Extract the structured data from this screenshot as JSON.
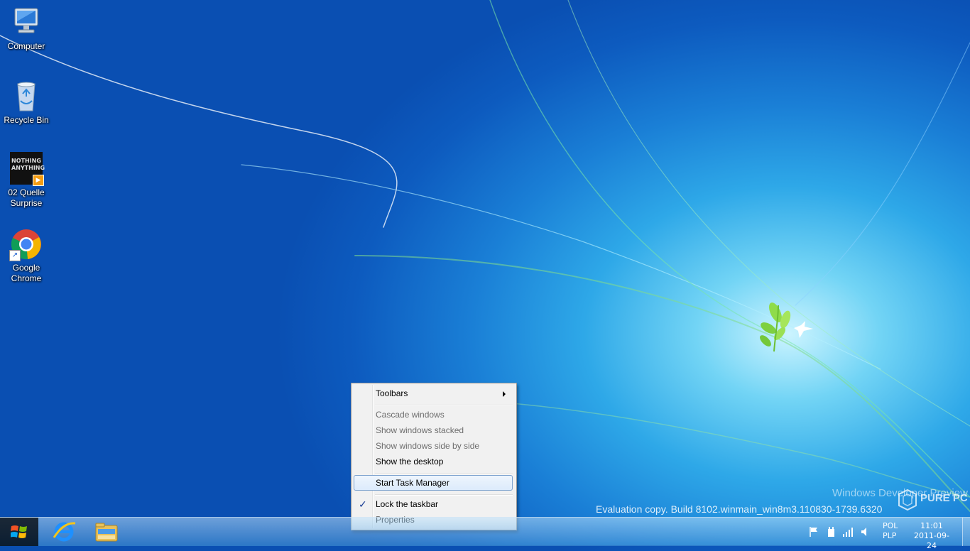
{
  "desktop": {
    "icons": [
      {
        "label": "Computer",
        "icon": "computer-icon"
      },
      {
        "label": "Recycle Bin",
        "icon": "recycle-bin-icon"
      },
      {
        "label": "02 Quelle Surprise",
        "icon": "media-file-icon"
      },
      {
        "label": "Google Chrome",
        "icon": "chrome-icon"
      }
    ],
    "media_cover_text": "NOTHING ANYTHING"
  },
  "watermark": {
    "title": "Windows Developer Preview",
    "build": "Evaluation copy. Build 8102.winmain_win8m3.110830-1739.6320"
  },
  "brand_logo_text": "PURE PC",
  "context_menu": {
    "items": [
      {
        "label": "Toolbars",
        "enabled": true,
        "has_submenu": true
      },
      {
        "label": "Cascade windows",
        "enabled": false
      },
      {
        "label": "Show windows stacked",
        "enabled": false
      },
      {
        "label": "Show windows side by side",
        "enabled": false
      },
      {
        "label": "Show the desktop",
        "enabled": true
      },
      {
        "label": "Start Task Manager",
        "enabled": true,
        "highlighted": true
      },
      {
        "label": "Lock the taskbar",
        "enabled": true,
        "checked": true
      },
      {
        "label": "Properties",
        "enabled": true
      }
    ]
  },
  "taskbar": {
    "start_icon": "windows-logo-icon",
    "pinned": [
      {
        "name": "Internet Explorer",
        "icon": "internet-explorer-icon"
      },
      {
        "name": "Windows Explorer",
        "icon": "file-explorer-icon"
      }
    ],
    "tray": {
      "icons": [
        "action-center-flag-icon",
        "power-icon",
        "network-signal-icon",
        "volume-icon"
      ],
      "language_top": "POL",
      "language_bottom": "PLP",
      "time": "11:01",
      "date": "2011-09-24"
    }
  },
  "colors": {
    "desktop_deep_blue": "#0a4fb2",
    "desktop_glow": "#ccf4ff",
    "menu_background": "#f1f1f1",
    "menu_highlight_border": "#7da2ce"
  }
}
